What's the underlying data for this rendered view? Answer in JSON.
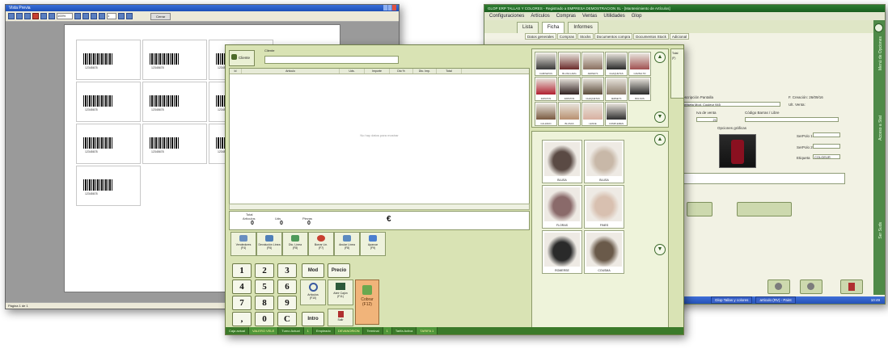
{
  "preview_window": {
    "title": "Vista Previa",
    "zoom": "100%",
    "page_field": "1",
    "close_label": "Cerrar",
    "barcode_number": "12345678",
    "status": "Página 1 de 1"
  },
  "articles_window": {
    "title": "GLOP ERP TALLAS Y COLORES - Registrado a EMPRESA DEMOSTRACION SL - [Mantenimiento de Artículos]",
    "menu": [
      "Configuraciones",
      "Artículos",
      "Compras",
      "Ventas",
      "Utilidades",
      "Glop"
    ],
    "tabs": [
      "Lista",
      "Ficha",
      "Informes"
    ],
    "subtabs": [
      "Datos generales",
      "Compras",
      "Stocks",
      "Documentos compra",
      "Documentos Stock",
      "Adicional"
    ],
    "side_labels": [
      "Menú de Opciones",
      "Acceso a Stat",
      "Ser Suds"
    ],
    "fields": {
      "descripcion_label": "Descripción Pantalla",
      "descripcion_value": "Camiseta Mod. Couleur 945",
      "fecha_label": "F. Creación: 26/09/16",
      "ult_label": "Ult. Venta:",
      "iva_label": "Iva de venta",
      "iva_value": "21",
      "barras_label": "Código Barras / Libre",
      "opciones_label": "Opciones gráficas",
      "color_value": "COLGEUR",
      "serpolo1": "SerPolo 1:",
      "serpolo2": "SerPolo 2:",
      "etiqueta": "Etiqueta"
    },
    "taskbar": [
      "Glop Tallas y colores",
      "articulo (RV) - Paint"
    ],
    "clock": "10:49"
  },
  "pos_window": {
    "client_button": "Cliente",
    "client_label": "Cliente",
    "grid_columns": [
      "Id",
      "Artículo",
      "Uds.",
      "Importe",
      "Dto %",
      "Dto. Imp.",
      "Total"
    ],
    "empty_message": "No hay datos para mostrar",
    "totals": {
      "total_label": "Total",
      "items_label": "Artículos",
      "items_value": "0",
      "uds_label": "Uds.",
      "uds_value": "0",
      "pieces_label": "Piezas",
      "pieces_value": "0",
      "currency": "€"
    },
    "function_keys": [
      {
        "label": "Vendedores",
        "key": "(F4)",
        "color": "#6a8fc0"
      },
      {
        "label": "Devolución Línea",
        "key": "(F6)",
        "color": "#4f7fb8"
      },
      {
        "label": "Dto. Línea",
        "key": "(F8)",
        "color": "#4f9a5a"
      },
      {
        "label": "Borrar Lin.",
        "key": "(F7)",
        "color": "#c84030"
      },
      {
        "label": "Anular Línea",
        "key": "(F8)",
        "color": "#5a8ac0"
      },
      {
        "label": "Aparcar",
        "key": "(F9)",
        "color": "#4c7fd0"
      }
    ],
    "keypad": [
      "1",
      "2",
      "3",
      "4",
      "5",
      "6",
      "7",
      "8",
      "9",
      ",",
      "0",
      "C"
    ],
    "keypad_extra": {
      "mod": "Mod",
      "precio": "Precio",
      "intro": "Intro"
    },
    "tool_buttons": [
      {
        "label": "Artículos",
        "key": "(F10)"
      },
      {
        "label": "Abrir Cajón",
        "key": "(F11)"
      },
      {
        "label": "Salir",
        "key": "(Esc)"
      }
    ],
    "cobrar": {
      "label": "Cobrar",
      "key": "(F12)"
    },
    "status": [
      {
        "label": "Caja actual",
        "value": "VALERO VELE"
      },
      {
        "label": "Turno Actual",
        "value": "1"
      },
      {
        "label": "Empleado",
        "value": "DEVANORION"
      },
      {
        "label": "Terminal",
        "value": "1"
      },
      {
        "label": "Tarifa Activa",
        "value": "TARIFA 1"
      }
    ],
    "families": [
      "CAMISETAS",
      "BLUSA LARG",
      "JERSEYS",
      "CHAQUETAS",
      "CAMISA TR",
      "ZAPATOS",
      "ZAPATOS",
      "CHAQUETAS",
      "JERSEYS",
      "BOLSOS",
      "CALZADO",
      "BLUSAS",
      "LENCE",
      "COMPLEMEN"
    ],
    "products": [
      "BLUSA",
      "BLUSA",
      "FLORAS",
      "FINES",
      "ROMERSE",
      "COUSMA"
    ],
    "total_side": {
      "label": "Total",
      "key": "(F)"
    }
  }
}
